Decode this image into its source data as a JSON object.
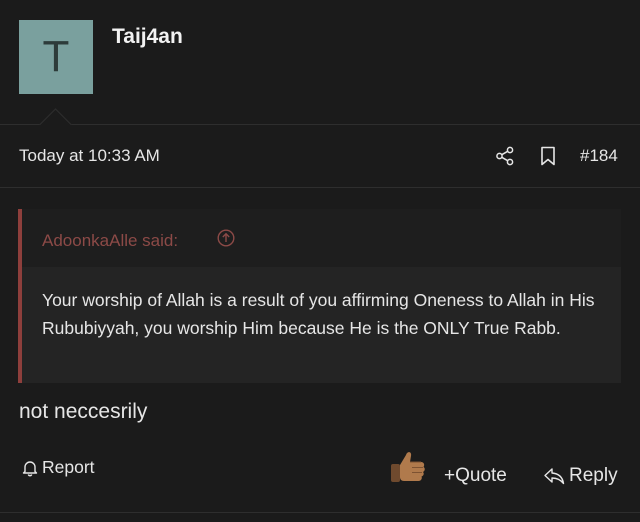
{
  "post": {
    "avatar_letter": "T",
    "username": "Taij4an",
    "timestamp": "Today at 10:33 AM",
    "post_number": "#184",
    "quote": {
      "author_line": "AdoonkaAlle said:",
      "body": "Your worship of Allah is a result of you affirming Oneness to Allah in His Rububiyyah, you worship Him because He is the ONLY True Rabb."
    },
    "message": "not neccesrily",
    "actions": {
      "report": "Report",
      "quote": "Quote",
      "reply": "Reply"
    }
  },
  "colors": {
    "background": "#1b1b1b",
    "avatar_bg": "#7aa09e",
    "quote_accent": "#8e3f3c",
    "quote_author": "#8c4a47"
  }
}
